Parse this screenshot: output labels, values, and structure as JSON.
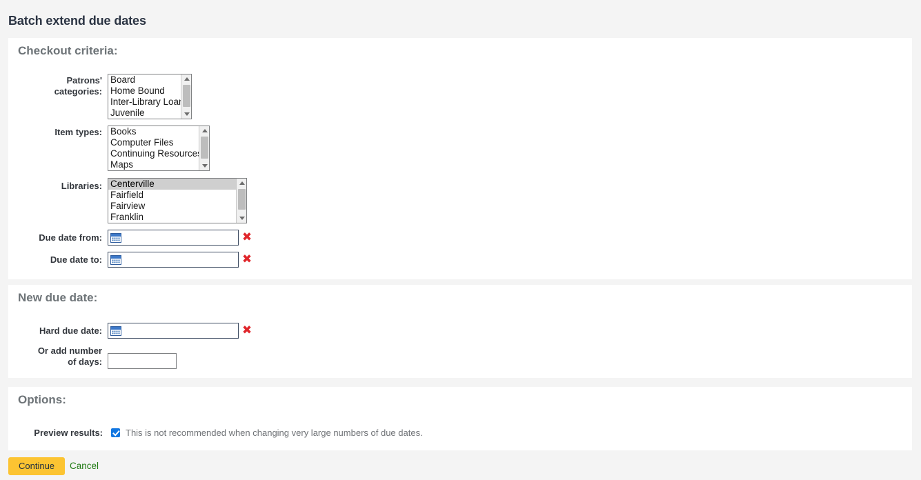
{
  "page": {
    "title": "Batch extend due dates"
  },
  "criteria": {
    "legend": "Checkout criteria:",
    "patron_categories": {
      "label": "Patrons' categories:",
      "options": [
        "Board",
        "Home Bound",
        "Inter-Library Loan",
        "Juvenile"
      ]
    },
    "item_types": {
      "label": "Item types:",
      "options": [
        "Books",
        "Computer Files",
        "Continuing Resources",
        "Maps"
      ]
    },
    "libraries": {
      "label": "Libraries:",
      "options": [
        "Centerville",
        "Fairfield",
        "Fairview",
        "Franklin"
      ],
      "selected": "Centerville"
    },
    "due_date_from": {
      "label": "Due date from:",
      "value": "",
      "placeholder": "",
      "calendar_icon": "calendar-icon",
      "clear_icon": "clear-x-icon"
    },
    "due_date_to": {
      "label": "Due date to:",
      "value": "",
      "placeholder": "",
      "calendar_icon": "calendar-icon",
      "clear_icon": "clear-x-icon"
    }
  },
  "new_due_date": {
    "legend": "New due date:",
    "hard_due_date": {
      "label": "Hard due date:",
      "value": "",
      "placeholder": "",
      "calendar_icon": "calendar-icon",
      "clear_icon": "clear-x-icon"
    },
    "add_days": {
      "label_line1": "Or add number",
      "label_line2": "of days:",
      "value": "",
      "placeholder": ""
    }
  },
  "options": {
    "legend": "Options:",
    "preview_results": {
      "label": "Preview results:",
      "checked": true,
      "hint": "This is not recommended when changing very large numbers of due dates."
    }
  },
  "footer": {
    "continue_label": "Continue",
    "cancel_label": "Cancel"
  },
  "colors": {
    "page_background": "#f4f4f4",
    "panel_background": "#ffffff",
    "title_text": "#2b3443",
    "legend_text": "#6e7478",
    "label_text": "#33373d",
    "accent_button": "#fcc432",
    "cancel_link": "#1f7a12",
    "clear_icon": "#e0262b",
    "checkbox_checked": "#1277e1",
    "listbox_selected": "#cfcfcf",
    "hint_text": "#6e7175"
  }
}
